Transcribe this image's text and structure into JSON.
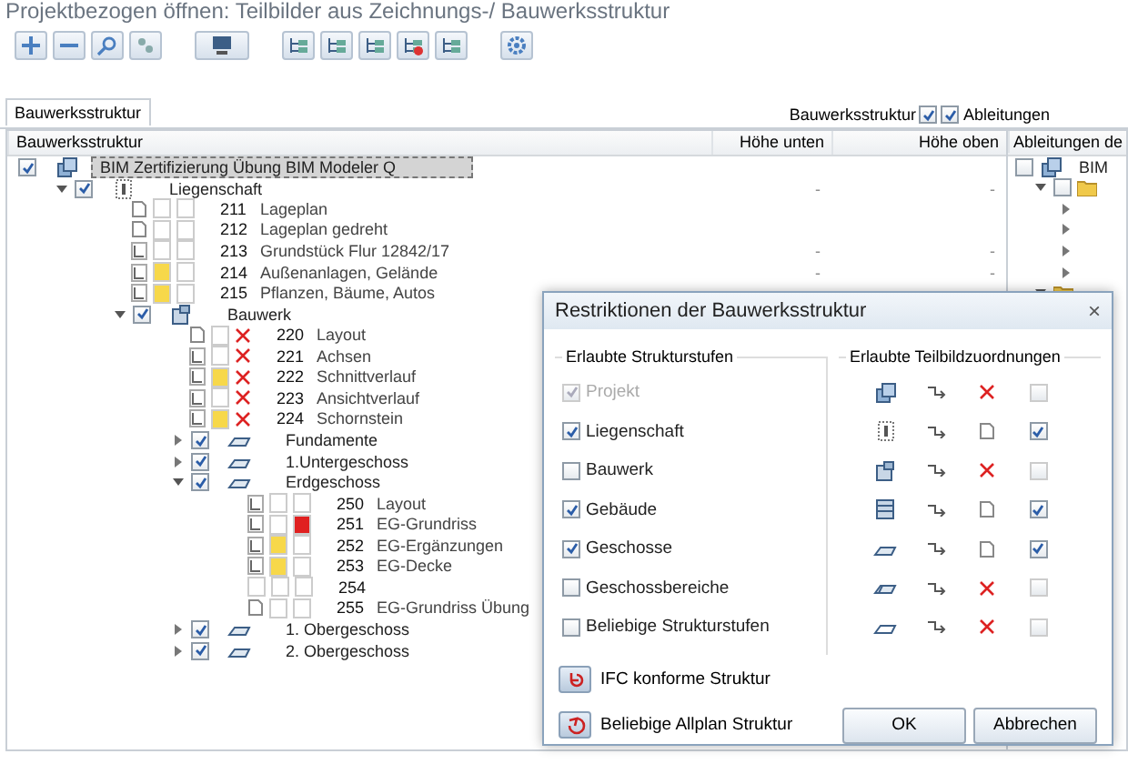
{
  "window": {
    "title": "Projektbezogen öffnen: Teilbilder aus Zeichnungs-/ Bauwerksstruktur"
  },
  "tabs": [
    {
      "label": "Bauwerksstruktur",
      "selected": true
    }
  ],
  "view_options": [
    {
      "label": "Bauwerksstruktur",
      "checked": true
    },
    {
      "label": "Ableitungen",
      "checked": true
    }
  ],
  "tree": {
    "columns": [
      "Bauwerksstruktur",
      "Höhe unten",
      "Höhe oben"
    ],
    "items": [
      {
        "kind": "project",
        "label": "BIM Zertifizierung Übung BIM Modeler Q",
        "checked": true,
        "selected": true,
        "children": [
          {
            "kind": "site",
            "label": "Liegenschaft",
            "checked": true,
            "selected": false,
            "expanded": true,
            "low": "-",
            "high": "-",
            "children": [
              {
                "kind": "page",
                "open": false,
                "excluded": false,
                "error": false,
                "number": "211",
                "label": "Lageplan"
              },
              {
                "kind": "page",
                "open": false,
                "excluded": false,
                "error": false,
                "number": "212",
                "label": "Lageplan gedreht"
              },
              {
                "kind": "plan",
                "open": false,
                "excluded": false,
                "error": false,
                "number": "213",
                "label": "Grundstück Flur 12842/17",
                "low": "-",
                "high": "-"
              },
              {
                "kind": "plan",
                "open": true,
                "excluded": false,
                "error": false,
                "number": "214",
                "label": "Außenanlagen, Gelände",
                "low": "-",
                "high": "-"
              },
              {
                "kind": "plan",
                "open": true,
                "excluded": false,
                "error": false,
                "number": "215",
                "label": "Pflanzen, Bäume, Autos"
              },
              {
                "kind": "building",
                "label": "Bauwerk",
                "checked": true,
                "selected": false,
                "expanded": true,
                "children": [
                  {
                    "kind": "page",
                    "open": false,
                    "excluded": true,
                    "error": false,
                    "number": "220",
                    "label": "Layout"
                  },
                  {
                    "kind": "plan",
                    "open": false,
                    "excluded": true,
                    "error": false,
                    "number": "221",
                    "label": "Achsen"
                  },
                  {
                    "kind": "plan",
                    "open": true,
                    "excluded": true,
                    "error": false,
                    "number": "222",
                    "label": "Schnittverlauf"
                  },
                  {
                    "kind": "plan",
                    "open": false,
                    "excluded": true,
                    "error": false,
                    "number": "223",
                    "label": "Ansichtverlauf"
                  },
                  {
                    "kind": "plan",
                    "open": true,
                    "excluded": true,
                    "error": false,
                    "number": "224",
                    "label": "Schornstein"
                  },
                  {
                    "kind": "floor",
                    "label": "Fundamente",
                    "checked": true,
                    "selected": false,
                    "expanded": false
                  },
                  {
                    "kind": "floor",
                    "label": "1.Untergeschoss",
                    "checked": true,
                    "selected": false,
                    "expanded": false
                  },
                  {
                    "kind": "floor",
                    "label": "Erdgeschoss",
                    "checked": true,
                    "selected": false,
                    "expanded": true,
                    "children": [
                      {
                        "kind": "plan",
                        "open": false,
                        "excluded": false,
                        "error": false,
                        "number": "250",
                        "label": "Layout"
                      },
                      {
                        "kind": "plan",
                        "open": false,
                        "excluded": false,
                        "error": true,
                        "number": "251",
                        "label": "EG-Grundriss"
                      },
                      {
                        "kind": "plan",
                        "open": true,
                        "excluded": false,
                        "error": false,
                        "number": "252",
                        "label": "EG-Ergänzungen"
                      },
                      {
                        "kind": "plan",
                        "open": true,
                        "excluded": false,
                        "error": false,
                        "number": "253",
                        "label": "EG-Decke"
                      },
                      {
                        "kind": "blank",
                        "open": false,
                        "excluded": false,
                        "error": false,
                        "number": "254"
                      },
                      {
                        "kind": "page",
                        "open": false,
                        "excluded": false,
                        "error": false,
                        "number": "255",
                        "label": "EG-Grundriss Übung"
                      }
                    ]
                  },
                  {
                    "kind": "floor",
                    "label": "1. Obergeschoss",
                    "checked": true,
                    "selected": false,
                    "expanded": false
                  },
                  {
                    "kind": "floor",
                    "label": "2. Obergeschoss",
                    "checked": true,
                    "selected": false,
                    "expanded": false
                  }
                ]
              }
            ]
          }
        ]
      }
    ]
  },
  "derived": {
    "header": "Ableitungen de",
    "items": [
      {
        "label": "BIM",
        "checked": false,
        "children": [
          {
            "checked": false,
            "expanded": true,
            "children": [
              {
                "expanded": false
              },
              {
                "expanded": false
              },
              {
                "expanded": false
              },
              {
                "expanded": false
              }
            ]
          },
          {
            "expanded": true
          }
        ]
      }
    ]
  },
  "dialog": {
    "title": "Restriktionen der Bauwerksstruktur",
    "close": "×",
    "levels_title": "Erlaubte Strukturstufen",
    "assign_title": "Erlaubte Teilbildzuordnungen",
    "levels": [
      {
        "label": "Projekt",
        "checked": true,
        "disabled": true,
        "kind": "project",
        "allowed": false,
        "assigned": false
      },
      {
        "label": "Liegenschaft",
        "checked": true,
        "disabled": false,
        "kind": "site",
        "allowed": true,
        "assigned": true
      },
      {
        "label": "Bauwerk",
        "checked": false,
        "disabled": false,
        "kind": "building",
        "allowed": false,
        "assigned": false
      },
      {
        "label": "Gebäude",
        "checked": true,
        "disabled": false,
        "kind": "house",
        "allowed": true,
        "assigned": true
      },
      {
        "label": "Geschosse",
        "checked": true,
        "disabled": false,
        "kind": "floor",
        "allowed": true,
        "assigned": true
      },
      {
        "label": "Geschossbereiche",
        "checked": false,
        "disabled": false,
        "kind": "area",
        "allowed": false,
        "assigned": false
      },
      {
        "label": "Beliebige Strukturstufen",
        "checked": false,
        "disabled": false,
        "kind": "any",
        "allowed": false,
        "assigned": false
      }
    ],
    "presets": [
      {
        "label": "IFC konforme Struktur",
        "kind": "ifc"
      },
      {
        "label": "Beliebige Allplan Struktur",
        "kind": "allplan"
      }
    ],
    "buttons": [
      "OK",
      "Abbrechen"
    ]
  }
}
